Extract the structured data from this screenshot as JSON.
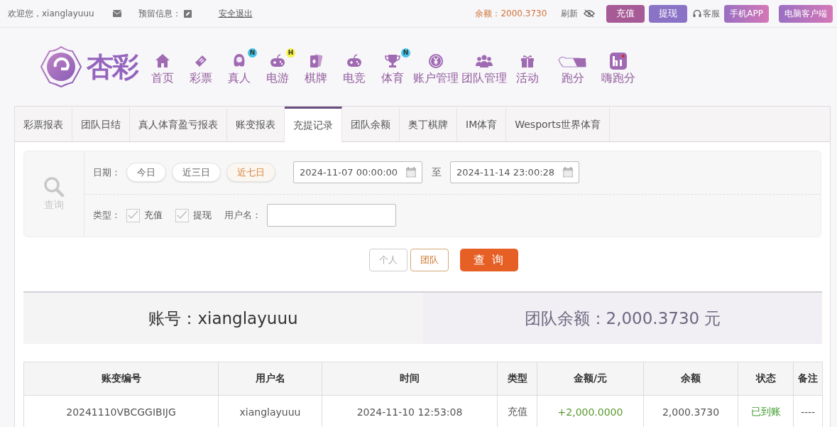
{
  "top_bar": {
    "greeting": "欢迎您，xianglayuuu",
    "reserved_info_label": "预留信息：",
    "logout": "安全退出",
    "balance": "余额：2000.3730",
    "refresh": "刷新",
    "buttons": [
      {
        "label": "充值",
        "kind": "deposit"
      },
      {
        "label": "提现",
        "kind": "withdraw"
      }
    ],
    "service": "客服",
    "apps": [
      "手机APP",
      "电脑客户端"
    ]
  },
  "logo": {
    "text": "杏彩"
  },
  "nav": [
    {
      "label": "首页"
    },
    {
      "label": "彩票"
    },
    {
      "label": "真人",
      "badge": "N"
    },
    {
      "label": "电游",
      "badge": "H"
    },
    {
      "label": "棋牌"
    },
    {
      "label": "电竞"
    },
    {
      "label": "体育",
      "badge": "N"
    },
    {
      "label": "账户管理"
    },
    {
      "label": "团队管理"
    },
    {
      "label": "活动"
    },
    {
      "label": "跑分"
    },
    {
      "label": "嗨跑分"
    }
  ],
  "tabs": [
    {
      "label": "彩票报表",
      "selected": false
    },
    {
      "label": "团队日结",
      "selected": false
    },
    {
      "label": "真人体育盈亏报表",
      "selected": false
    },
    {
      "label": "账变报表",
      "selected": false
    },
    {
      "label": "充提记录",
      "selected": true
    },
    {
      "label": "团队余额",
      "selected": false
    },
    {
      "label": "奥丁棋牌",
      "selected": false
    },
    {
      "label": "IM体育",
      "selected": false
    },
    {
      "label": "Wesports世界体育",
      "selected": false
    }
  ],
  "filter": {
    "search_label": "查询",
    "date_label": "日期：",
    "quick_ranges": [
      {
        "label": "今日",
        "selected": false
      },
      {
        "label": "近三日",
        "selected": false
      },
      {
        "label": "近七日",
        "selected": true
      }
    ],
    "start": "2024-11-07 00:00:00",
    "to": "至",
    "end": "2024-11-14 23:00:28",
    "type_label": "类型：",
    "types": [
      {
        "label": "充值",
        "checked": true
      },
      {
        "label": "提现",
        "checked": true
      }
    ],
    "username_label": "用户名："
  },
  "scope": [
    {
      "label": "个人",
      "selected": false
    },
    {
      "label": "团队",
      "selected": true
    }
  ],
  "query_button": "查 询",
  "summary": {
    "account": "账号：xianglayuuu",
    "team_balance": "团队余额：2,000.3730 元"
  },
  "table": {
    "columns": [
      "账变编号",
      "用户名",
      "时间",
      "类型",
      "金额/元",
      "余额",
      "状态",
      "备注"
    ],
    "rows": [
      {
        "cells": [
          "20241110VBCGGIBIJG",
          "xianglayuuu",
          "2024-11-10 12:53:08",
          "充值",
          "+2,000.0000",
          "2,000.3730",
          "已到账",
          "----"
        ],
        "amount_positive": true,
        "arrived": true
      }
    ]
  }
}
